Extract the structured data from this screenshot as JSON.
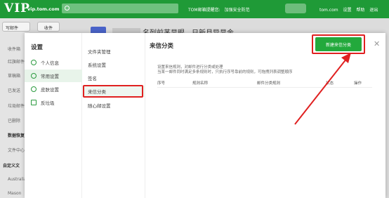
{
  "header": {
    "logo": "VIP",
    "domain": "vip.tom.com",
    "links": [
      "TOM邮箱提醒您:",
      "加强安全防范"
    ],
    "account_suffix": "tom.com",
    "account_links": [
      "设置",
      "帮助",
      "退出"
    ]
  },
  "leftnav": {
    "compose": "写邮件",
    "receive": "收件",
    "items": [
      "收件箱",
      "红旗邮件",
      "草稿箱",
      "已发送",
      "垃圾邮件",
      "已删除",
      "数据恢复",
      "文件中心",
      "自定义文",
      "Australia",
      "Mason"
    ]
  },
  "greeting": "名列前茅显眼，日新月异显金。",
  "modal": {
    "title": "设置",
    "side_items": [
      {
        "label": "个人信息",
        "icon": "person-icon"
      },
      {
        "label": "常用设置",
        "icon": "gear-icon"
      },
      {
        "label": "皮肤设置",
        "icon": "skin-icon"
      },
      {
        "label": "反垃圾",
        "icon": "trash-icon"
      }
    ],
    "sub_items": [
      "文件夹管理",
      "系统设置",
      "签名",
      "来信分类",
      "随心邮设置"
    ],
    "content": {
      "title": "来信分类",
      "new_button": "新建来信分类",
      "desc_line1": "设置来信规则，对邮件进行分类或处理",
      "desc_line2": "当某一邮件同时满足多条规则时，只执行序号靠前的规则，可拖拽列表调整顺序",
      "columns": [
        "序号",
        "规则名称",
        "邮件分类规则",
        "状态",
        "操作"
      ]
    }
  },
  "colors": {
    "brand_green": "#1f9a37",
    "button_green": "#23a93c",
    "annotation_red": "#e02020"
  }
}
